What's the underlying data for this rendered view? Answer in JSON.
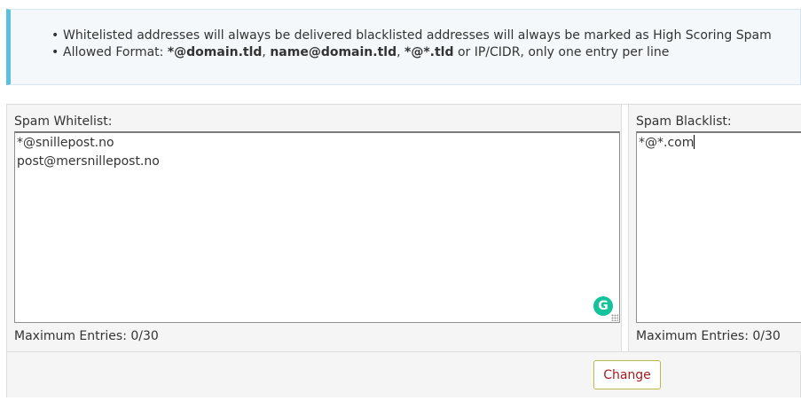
{
  "info": {
    "line1": "Whitelisted addresses will always be delivered blacklisted addresses will always be marked as High Scoring Spam",
    "line2_prefix": "Allowed Format: ",
    "format1": "*@domain.tld",
    "sep1": ", ",
    "format2": "name@domain.tld",
    "sep2": ", ",
    "format3": "*@*.tld",
    "line2_suffix": " or IP/CIDR, only one entry per line"
  },
  "whitelist": {
    "label": "Spam Whitelist:",
    "entries": [
      "*@snillepost.no",
      "post@mersnillepost.no"
    ],
    "max_entries": "Maximum Entries: 0/30"
  },
  "blacklist": {
    "label": "Spam Blacklist:",
    "entries": [
      "*@*.com"
    ],
    "max_entries": "Maximum Entries: 0/30"
  },
  "actions": {
    "change_label": "Change"
  },
  "icons": {
    "grammarly": "grammarly-icon",
    "resize": "resize-grip-icon"
  },
  "colors": {
    "info_accent": "#5bc0de",
    "change_text": "#a31d1d",
    "grammarly": "#15c39a"
  }
}
